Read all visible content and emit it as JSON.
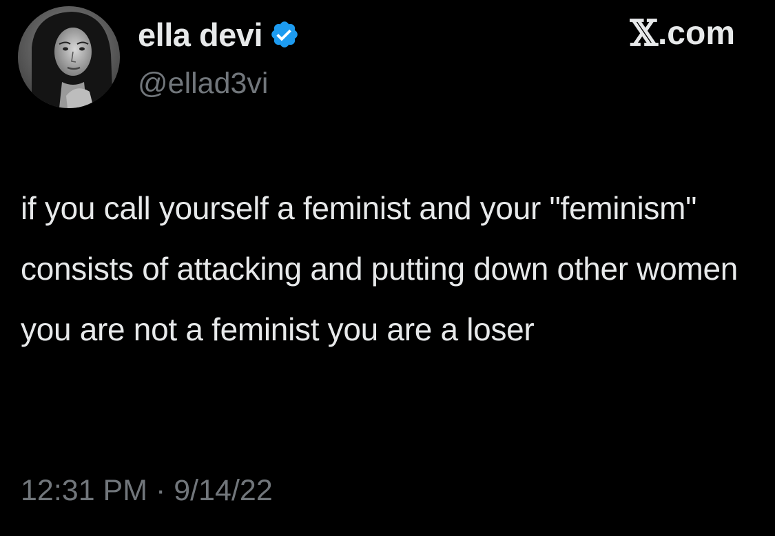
{
  "tweet": {
    "author": {
      "display_name": "ella devi",
      "handle": "@ellad3vi",
      "verified": true,
      "verified_icon": "verified-badge-icon",
      "verified_color": "#1d9bf0"
    },
    "brand": {
      "x_glyph": "𝕏",
      "suffix": ".com"
    },
    "text": "if you call yourself a feminist and your \"feminism\" consists of attacking and putting down other women you are not a feminist you are a loser",
    "timestamp": "12:31 PM · 9/14/22"
  },
  "colors": {
    "background": "#000000",
    "primary_text": "#e7e9ea",
    "secondary_text": "#71767b"
  }
}
